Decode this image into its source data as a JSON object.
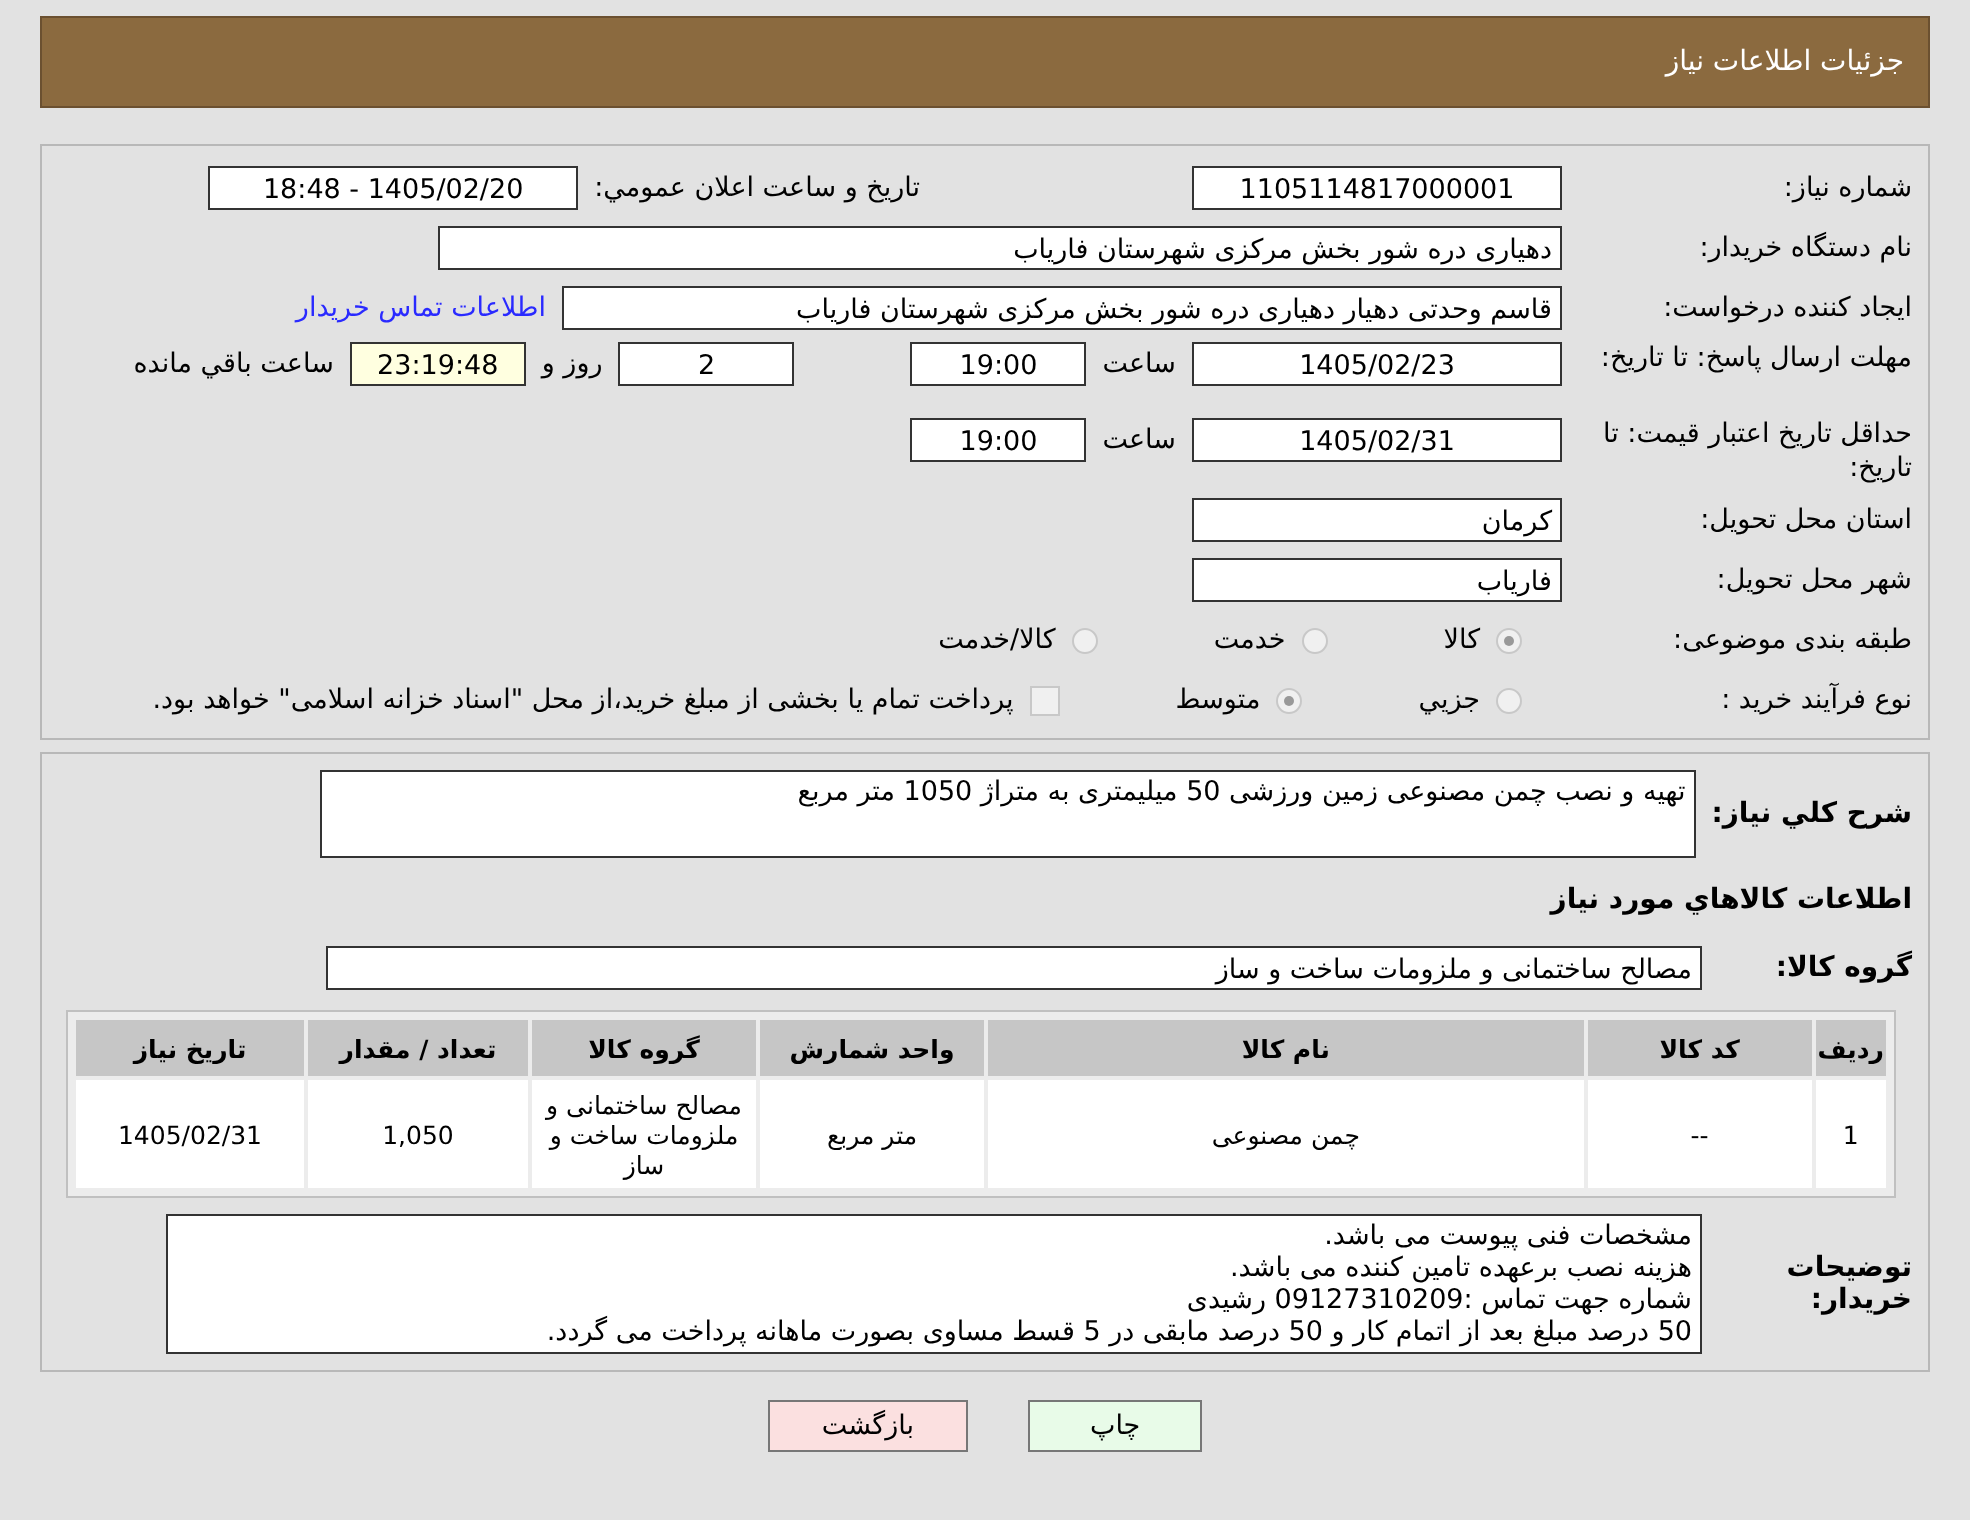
{
  "header": {
    "title": "جزئیات اطلاعات نیاز"
  },
  "fields": {
    "need_number": {
      "label": "شماره نیاز:",
      "value": "1105114817000001"
    },
    "announce": {
      "label": "تاريخ و ساعت اعلان عمومي:",
      "value": "1405/02/20 - 18:48"
    },
    "buyer": {
      "label": "نام دستگاه خريدار:",
      "value": "دهیاری دره شور بخش مرکزی شهرستان فاریاب"
    },
    "creator": {
      "label": "ايجاد کننده درخواست:",
      "value": "قاسم وحدتی دهیار دهیاری دره شور بخش مرکزی شهرستان فاریاب",
      "link": "اطلاعات تماس خريدار"
    },
    "deadline": {
      "label": "مهلت ارسال پاسخ: تا تاريخ:",
      "date": "1405/02/23",
      "time_label": "ساعت",
      "time": "19:00",
      "days": "2",
      "days_label": "روز و",
      "remaining": "23:19:48",
      "remaining_label": "ساعت باقي مانده"
    },
    "validity": {
      "label": "حداقل تاريخ اعتبار قيمت: تا تاريخ:",
      "date": "1405/02/31",
      "time_label": "ساعت",
      "time": "19:00"
    },
    "province": {
      "label": "استان محل تحويل:",
      "value": "کرمان"
    },
    "city": {
      "label": "شهر محل تحويل:",
      "value": "فاریاب"
    }
  },
  "category": {
    "label": "طبقه بندی موضوعی:",
    "options": [
      {
        "label": "کالا",
        "selected": true
      },
      {
        "label": "خدمت",
        "selected": false
      },
      {
        "label": "کالا/خدمت",
        "selected": false
      }
    ]
  },
  "purchase_type": {
    "label": "نوع فرآيند خريد :",
    "options": [
      {
        "label": "جزيي",
        "selected": false
      },
      {
        "label": "متوسط",
        "selected": true
      }
    ],
    "payment": {
      "label": "پرداخت تمام يا بخشی از مبلغ خريد،از محل \"اسناد خزانه اسلامی\" خواهد بود.",
      "checked": false
    }
  },
  "summary": {
    "label": "شرح کلي نياز:",
    "value": "تهیه و نصب چمن مصنوعی زمین ورزشی 50 میلیمتری به متراژ 1050 متر مربع"
  },
  "goods_title": "اطلاعات کالاهاي مورد نياز",
  "goods_group": {
    "label": "گروه کالا:",
    "value": "مصالح ساختمانی و ملزومات ساخت و ساز"
  },
  "table": {
    "columns": [
      "رديف",
      "کد کالا",
      "نام کالا",
      "واحد شمارش",
      "گروه کالا",
      "تعداد / مقدار",
      "تاريخ نياز"
    ],
    "rows": [
      [
        "1",
        "--",
        "چمن مصنوعی",
        "متر مربع",
        "مصالح ساختمانی و ملزومات ساخت و ساز",
        "1,050",
        "1405/02/31"
      ]
    ]
  },
  "notes": {
    "label": "توضيحات خريدار:",
    "lines": [
      "مشخصات فنی پیوست می باشد.",
      "هزینه نصب برعهده تامین کننده می باشد.",
      "شماره جهت تماس :09127310209 رشیدی",
      "50 درصد مبلغ بعد از اتمام کار و 50 درصد مابقی در 5 قسط مساوی بصورت ماهانه پرداخت می گردد."
    ]
  },
  "buttons": {
    "print": "چاپ",
    "back": "بازگشت"
  }
}
